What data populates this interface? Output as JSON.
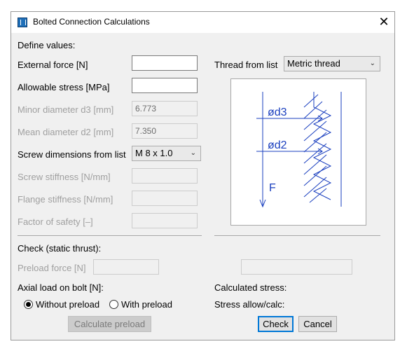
{
  "window": {
    "title": "Bolted Connection Calculations",
    "close_symbol": "✕"
  },
  "left": {
    "define_values": "Define values:",
    "external_force_label": "External force [N]",
    "external_force_value": "",
    "allowable_stress_label": "Allowable stress [MPa]",
    "allowable_stress_value": "",
    "minor_diameter_label": "Minor diameter d3 [mm]",
    "minor_diameter_value": "6.773",
    "mean_diameter_label": "Mean diameter d2 [mm]",
    "mean_diameter_value": "7.350",
    "screw_dimensions_label": "Screw dimensions from list",
    "screw_dimensions_value": "M 8 x 1.0",
    "screw_stiffness_label": "Screw stiffness [N/mm]",
    "flange_stiffness_label": "Flange stiffness [N/mm]",
    "factor_safety_label": "Factor of safety [–]"
  },
  "right": {
    "thread_label": "Thread from list",
    "thread_value": "Metric thread",
    "figure": {
      "d3_label": "ød3",
      "d2_label": "ød2",
      "force_label": "F"
    },
    "calculated_stress_label": "Calculated stress:",
    "stress_ratio_label": "Stress allow/calc:"
  },
  "check": {
    "section_label": "Check (static thrust):",
    "preload_force_label": "Preload force [N]",
    "axial_load_label": "Axial load on bolt [N]:",
    "radio_without": "Without preload",
    "radio_with": "With preload",
    "selected": "without"
  },
  "buttons": {
    "calculate_preload": "Calculate preload",
    "check": "Check",
    "cancel": "Cancel"
  },
  "colors": {
    "accent": "#0078d7",
    "figure_line": "#1a3fbf"
  }
}
